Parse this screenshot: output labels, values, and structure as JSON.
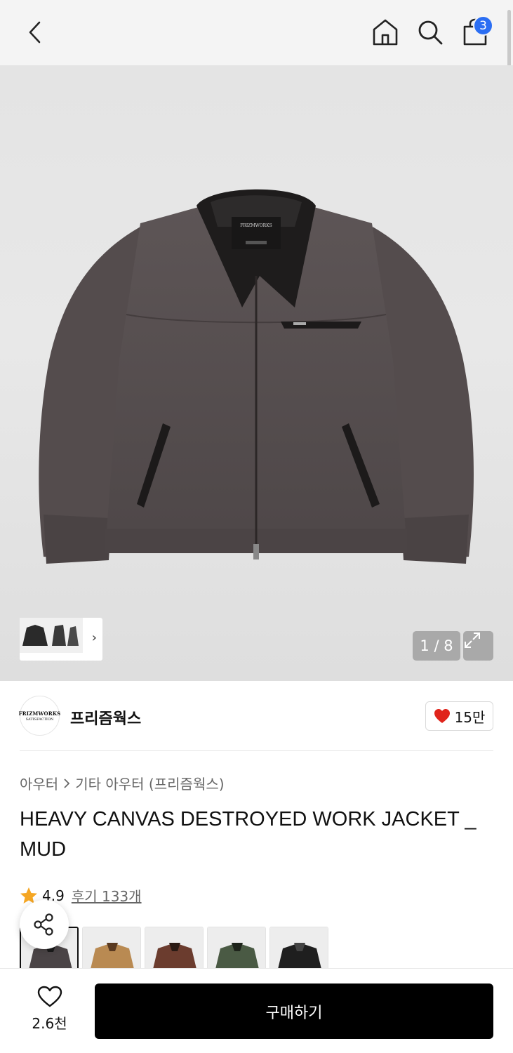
{
  "header": {
    "cart_count": "3"
  },
  "gallery": {
    "counter": "1 / 8"
  },
  "brand": {
    "name": "프리즘웍스",
    "logo_line1": "FRIZMWORKS",
    "logo_line2": "SATISFACTION",
    "likes": "15만"
  },
  "product": {
    "breadcrumb": [
      "아우터",
      "기타 아우터 (프리즘웍스)"
    ],
    "title": "HEAVY CANVAS DESTROYED WORK JACKET _ MUD",
    "rating": "4.9",
    "reviews": "후기 133개"
  },
  "swatches": [
    {
      "color": "#4a4446",
      "name": "mud"
    },
    {
      "color": "#b98a52",
      "name": "camel"
    },
    {
      "color": "#6b3c2e",
      "name": "brown"
    },
    {
      "color": "#4a5a44",
      "name": "olive"
    },
    {
      "color": "#1f1f1f",
      "name": "black"
    }
  ],
  "bottom": {
    "wish_count": "2.6천",
    "buy_label": "구매하기"
  },
  "colors": {
    "accent_badge": "#2b6ef3",
    "heart": "#e0241b",
    "star": "#f5a623",
    "buy_button": "#000000"
  }
}
